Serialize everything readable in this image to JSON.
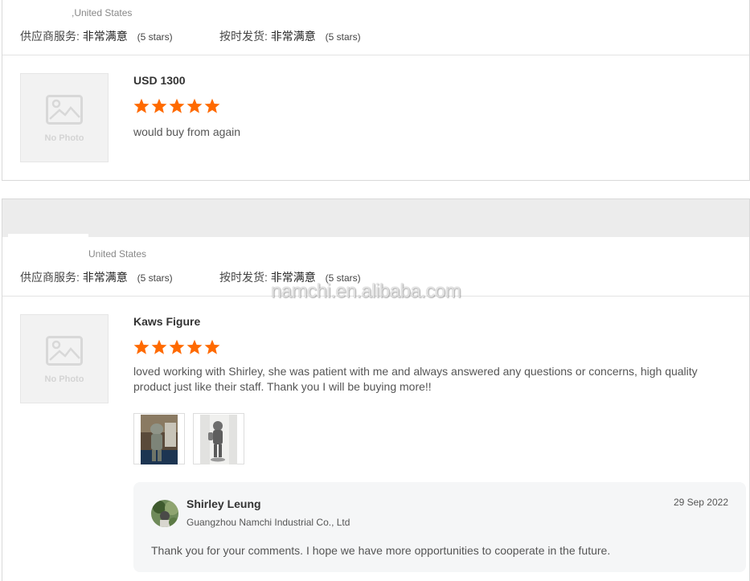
{
  "colors": {
    "star": "#ff6a00",
    "accent_text": "#333333",
    "muted": "#888888",
    "reply_bg": "#f5f6f7"
  },
  "reviews": [
    {
      "country": ",United States",
      "supplier_service_label": "供应商服务:",
      "supplier_service_value": "非常满意",
      "supplier_service_stars": "(5 stars)",
      "ontime_label": "按时发货:",
      "ontime_value": "非常满意",
      "ontime_stars": "(5 stars)",
      "product_image_text": "No Photo",
      "product_image_icon": "picture-icon",
      "product_title": "USD 1300",
      "rating": 5,
      "comment": "would buy from again"
    },
    {
      "country": "United States",
      "supplier_service_label": "供应商服务:",
      "supplier_service_value": "非常满意",
      "supplier_service_stars": "(5 stars)",
      "ontime_label": "按时发货:",
      "ontime_value": "非常满意",
      "ontime_stars": "(5 stars)",
      "product_image_text": "No Photo",
      "product_image_icon": "picture-icon",
      "product_title": "Kaws Figure",
      "rating": 5,
      "comment": "loved working with Shirley, she was patient with me and always answered any questions or concerns, high quality product just like their staff. Thank you I will be buying more!!",
      "attached_photos": 2,
      "reply": {
        "name": "Shirley Leung",
        "company": "Guangzhou Namchi Industrial Co., Ltd",
        "date": "29 Sep 2022",
        "text": "Thank you for your comments. I hope we have more opportunities to cooperate in the future."
      }
    }
  ],
  "watermark": "namchi.en.alibaba.com"
}
